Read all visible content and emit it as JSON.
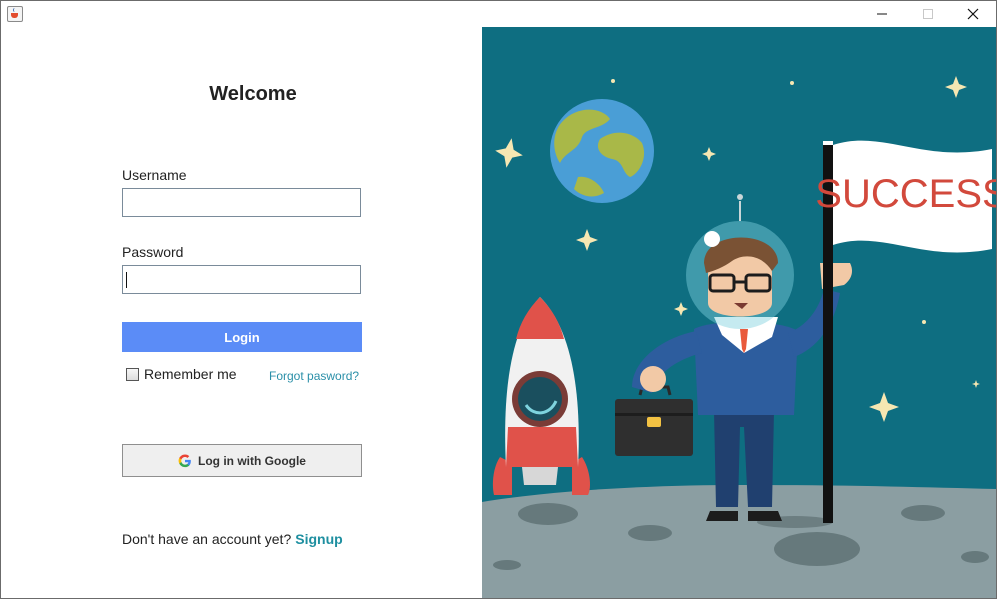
{
  "window": {
    "minimize_icon": "minimize-icon",
    "maximize_icon": "maximize-icon",
    "close_icon": "close-icon"
  },
  "login": {
    "title": "Welcome",
    "username_label": "Username",
    "username_value": "",
    "password_label": "Password",
    "password_value": "",
    "login_button": "Login",
    "remember_label": "Remember me",
    "remember_checked": false,
    "forgot_link": "Forgot pasword?",
    "google_button": "Log in with Google",
    "signup_prompt": "Don't have an account yet?",
    "signup_link": "Signup"
  },
  "illustration": {
    "flag_text": "SUCCESS",
    "colors": {
      "sky": "#0e6e81",
      "ground": "#8b9ea2",
      "accent": "#5b8cf7",
      "link": "#2a8fa8"
    }
  }
}
